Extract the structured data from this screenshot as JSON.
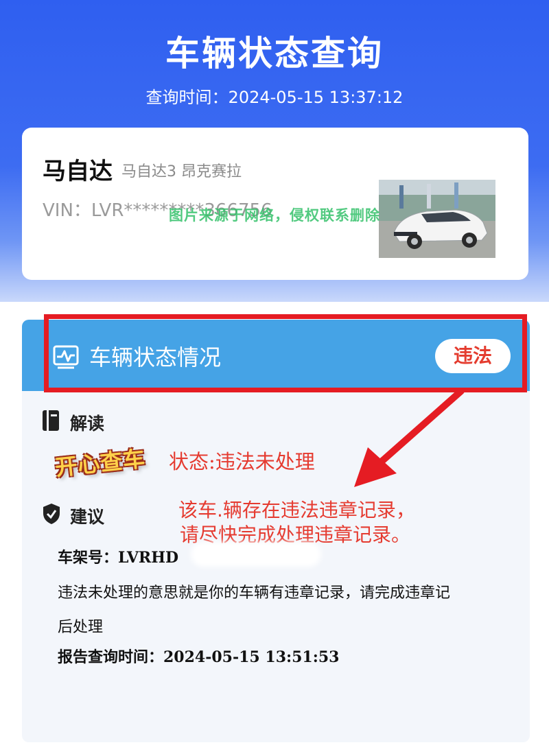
{
  "header": {
    "title": "车辆状态查询",
    "query_time_label": "查询时间：",
    "query_time": "2024-05-15 13:37:12"
  },
  "vehicle": {
    "brand": "马自达",
    "model": "马自达3 昂克赛拉",
    "vin_label": "VIN：",
    "vin": "LVR*********366756"
  },
  "watermark": "图片来源于网络，侵权联系删除",
  "status": {
    "title": "车辆状态情况",
    "badge": "违法",
    "badge_color": "#e43c2f",
    "header_color": "#45a3e6"
  },
  "interpretation": {
    "title": "解读",
    "status_text": "状态:违法未处理"
  },
  "sticker": "开心查车",
  "annotation": {
    "line1": "该车.辆存在违法违章记录，",
    "line2": "请尽快完成处理违章记录。"
  },
  "suggestion": {
    "title": "建议",
    "frame_no": "车架号：LVRHD",
    "line1": "违法未处理的意思就是你的车辆有违章记录，请完成违章记",
    "line2": "后处理",
    "report_time": "报告查询时间：2024-05-15 13:51:53"
  },
  "icons": {
    "interpretation": "book-icon",
    "suggestion": "shield-check-icon",
    "status": "monitor-chart-icon"
  },
  "colors": {
    "brand_blue": "#2f5ff0",
    "alert_red": "#e51c23"
  }
}
